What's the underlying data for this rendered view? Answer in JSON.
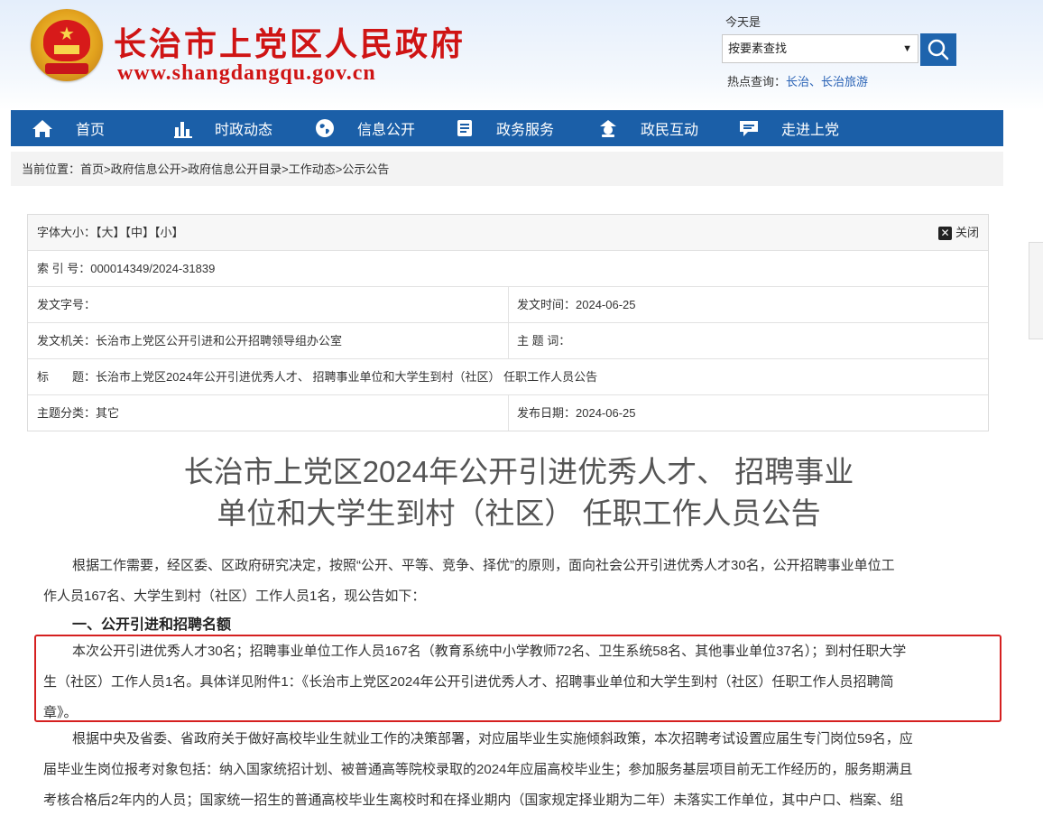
{
  "header": {
    "site_title": "长治市上党区人民政府",
    "site_url": "www.shangdangqu.gov.cn",
    "today_label": "今天是",
    "search_select": "按要素查找",
    "hot_label": "热点查询：",
    "hot_links": [
      "长治、",
      "长治旅游"
    ]
  },
  "nav": [
    {
      "label": "首页",
      "icon": "home-icon"
    },
    {
      "label": "时政动态",
      "icon": "chart-icon"
    },
    {
      "label": "信息公开",
      "icon": "globe-icon"
    },
    {
      "label": "政务服务",
      "icon": "document-icon"
    },
    {
      "label": "政民互动",
      "icon": "person-icon"
    },
    {
      "label": "走进上党",
      "icon": "chat-icon"
    }
  ],
  "breadcrumb": "当前位置：首页>政府信息公开>政府信息公开目录>工作动态>公示公告",
  "info": {
    "font_size_label": "字体大小：【大】【中】【小】",
    "close_label": "关闭",
    "index_no": "索 引 号：000014349/2024-31839",
    "doc_no": "发文字号：",
    "issue_time": "发文时间：2024-06-25",
    "issuer": "发文机关：长治市上党区公开引进和公开招聘领导组办公室",
    "subject_words": "主 题 词：",
    "title_label": "标　　题：",
    "title_value": "长治市上党区2024年公开引进优秀人才、 招聘事业单位和大学生到村（社区） 任职工作人员公告",
    "category": "主题分类：其它",
    "publish_date": "发布日期：2024-06-25"
  },
  "article": {
    "title_line1": "长治市上党区2024年公开引进优秀人才、 招聘事业",
    "title_line2": "单位和大学生到村（社区） 任职工作人员公告",
    "p1_line1": "根据工作需要，经区委、区政府研究决定，按照“公开、平等、竞争、择优”的原则，面向社会公开引进优秀人才30名，公开招聘事业单位工",
    "p1_line2": "作人员167名、大学生到村（社区）工作人员1名，现公告如下：",
    "section1": "一、公开引进和招聘名额",
    "p2_line1": "本次公开引进优秀人才30名；招聘事业单位工作人员167名（教育系统中小学教师72名、卫生系统58名、其他事业单位37名）；到村任职大学",
    "p2_line2": "生（社区）工作人员1名。具体详见附件1：《长治市上党区2024年公开引进优秀人才、招聘事业单位和大学生到村（社区）任职工作人员招聘简",
    "p2_line3": "章》。",
    "p3_line1": "根据中央及省委、省政府关于做好高校毕业生就业工作的决策部署，对应届毕业生实施倾斜政策，本次招聘考试设置应届生专门岗位59名，应",
    "p3_line2": "届毕业生岗位报考对象包括：纳入国家统招计划、被普通高等院校录取的2024年应届高校毕业生；参加服务基层项目前无工作经历的，服务期满且",
    "p3_line3": "考核合格后2年内的人员；国家统一招生的普通高校毕业生离校时和在择业期内（国家规定择业期为二年）未落实工作单位，其中户口、档案、组"
  },
  "colors": {
    "brand_red": "#cf1414",
    "nav_blue": "#1b5fa8",
    "highlight_red": "#d52020"
  }
}
